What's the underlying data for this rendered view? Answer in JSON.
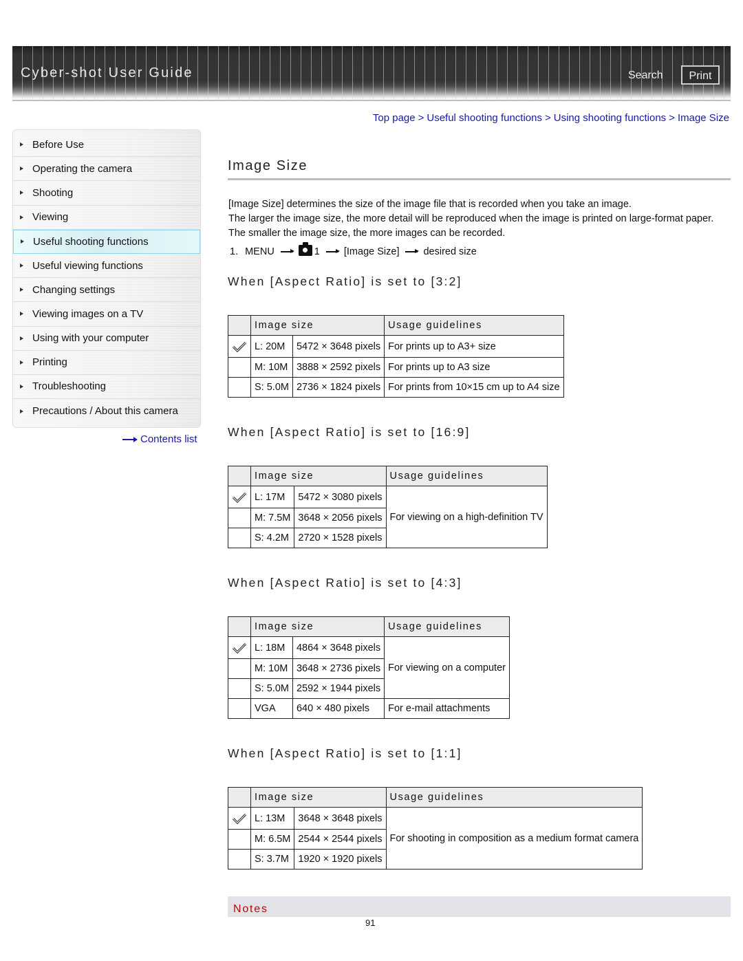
{
  "header": {
    "app_title": "Cyber-shot User Guide",
    "search_label": "Search",
    "print_label": "Print"
  },
  "breadcrumb": [
    {
      "label": "Top page"
    },
    {
      "label": "Useful shooting functions"
    },
    {
      "label": "Using shooting functions"
    },
    {
      "label": "Image Size"
    }
  ],
  "breadcrumb_separator": ">",
  "sidebar": {
    "items": [
      {
        "label": "Before Use",
        "active": false
      },
      {
        "label": "Operating the camera",
        "active": false
      },
      {
        "label": "Shooting",
        "active": false
      },
      {
        "label": "Viewing",
        "active": false
      },
      {
        "label": "Useful shooting functions",
        "active": true
      },
      {
        "label": "Useful viewing functions",
        "active": false
      },
      {
        "label": "Changing settings",
        "active": false
      },
      {
        "label": "Viewing images on a TV",
        "active": false
      },
      {
        "label": "Using with your computer",
        "active": false
      },
      {
        "label": "Printing",
        "active": false
      },
      {
        "label": "Troubleshooting",
        "active": false
      },
      {
        "label": "Precautions / About this camera",
        "active": false
      }
    ],
    "contents_link": "Contents list"
  },
  "main": {
    "title": "Image Size",
    "intro": [
      "[Image Size] determines the size of the image file that is recorded when you take an image.",
      "The larger the image size, the more detail will be reproduced when the image is printed on large-format paper. The smaller the image size, the more images can be recorded."
    ],
    "step": {
      "number": "1.",
      "menu": "MENU",
      "icon": "camera-icon",
      "tab_number": "1",
      "item": "[Image Size]",
      "result": "desired size"
    },
    "table_headers": {
      "image_size": "Image size",
      "usage": "Usage guidelines"
    },
    "sections": [
      {
        "title": "When [Aspect Ratio] is set to [3:2]",
        "rows": [
          {
            "default": true,
            "size": "L: 20M",
            "pixels": "5472 × 3648 pixels",
            "usage": "For prints up to A3+ size"
          },
          {
            "default": false,
            "size": "M: 10M",
            "pixels": "3888 × 2592 pixels",
            "usage": "For prints up to A3 size"
          },
          {
            "default": false,
            "size": "S: 5.0M",
            "pixels": "2736 × 1824 pixels",
            "usage": "For prints from 10×15 cm up to A4 size"
          }
        ]
      },
      {
        "title": "When [Aspect Ratio] is set to [16:9]",
        "rows": [
          {
            "default": true,
            "size": "L: 17M",
            "pixels": "5472 × 3080 pixels"
          },
          {
            "default": false,
            "size": "M: 7.5M",
            "pixels": "3648 × 2056 pixels"
          },
          {
            "default": false,
            "size": "S: 4.2M",
            "pixels": "2720 × 1528 pixels"
          }
        ],
        "merged_usage": "For viewing on a high-definition TV"
      },
      {
        "title": "When [Aspect Ratio] is set to [4:3]",
        "rows": [
          {
            "default": true,
            "size": "L: 18M",
            "pixels": "4864 × 3648 pixels"
          },
          {
            "default": false,
            "size": "M: 10M",
            "pixels": "3648 × 2736 pixels"
          },
          {
            "default": false,
            "size": "S: 5.0M",
            "pixels": "2592 × 1944 pixels"
          },
          {
            "default": false,
            "size": "VGA",
            "pixels": "640 × 480 pixels",
            "usage": "For e-mail attachments"
          }
        ],
        "merged_usage": "For viewing on a computer"
      },
      {
        "title": "When [Aspect Ratio] is set to [1:1]",
        "rows": [
          {
            "default": true,
            "size": "L: 13M",
            "pixels": "3648 × 3648 pixels"
          },
          {
            "default": false,
            "size": "M: 6.5M",
            "pixels": "2544 × 2544 pixels"
          },
          {
            "default": false,
            "size": "S: 3.7M",
            "pixels": "1920 × 1920 pixels"
          }
        ],
        "merged_usage": "For shooting in composition as a medium format camera"
      }
    ],
    "notes_label": "Notes",
    "page_number": "91"
  },
  "colors": {
    "link": "#1a1aa6",
    "notes_label": "#c00000",
    "active_nav_bg": "#d6eff3",
    "active_nav_border": "#8fd6ea",
    "table_header_bg": "#ececec",
    "notes_bar_bg": "#e1e3e8"
  }
}
